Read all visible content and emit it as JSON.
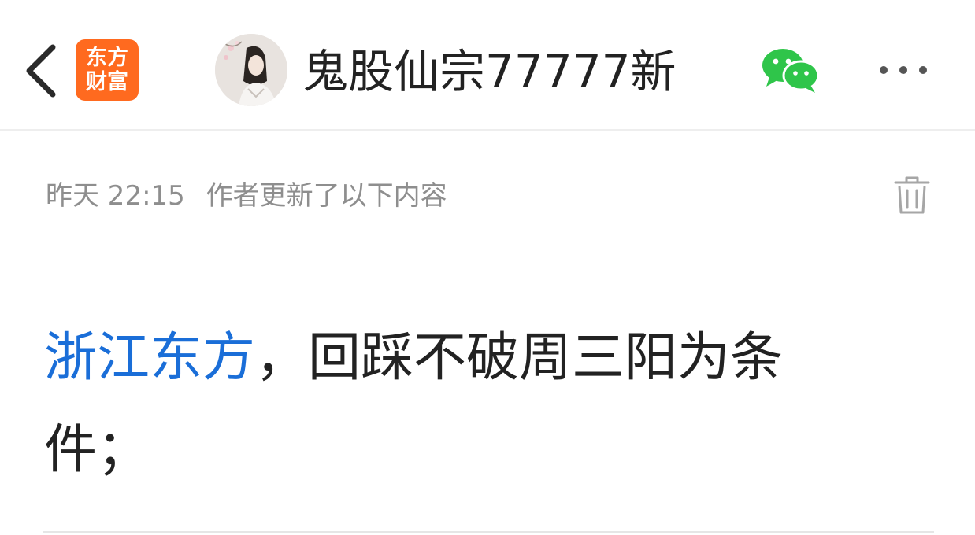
{
  "header": {
    "back_icon": "chevron-left-icon",
    "logo_line1": "东方",
    "logo_line2": "财富",
    "logo_color": "#ff6a1f",
    "author_name": "鬼股仙宗77777新",
    "share_icon": "wechat-icon",
    "share_icon_color": "#2fc54a",
    "more_icon": "more-icon"
  },
  "post": {
    "timestamp": "昨天 22:15",
    "update_note": "作者更新了以下内容",
    "delete_icon": "trash-icon",
    "stock_link": "浙江东方",
    "stock_link_color": "#1a6ed8",
    "body_text": "，回踩不破周三阳为条件；"
  }
}
